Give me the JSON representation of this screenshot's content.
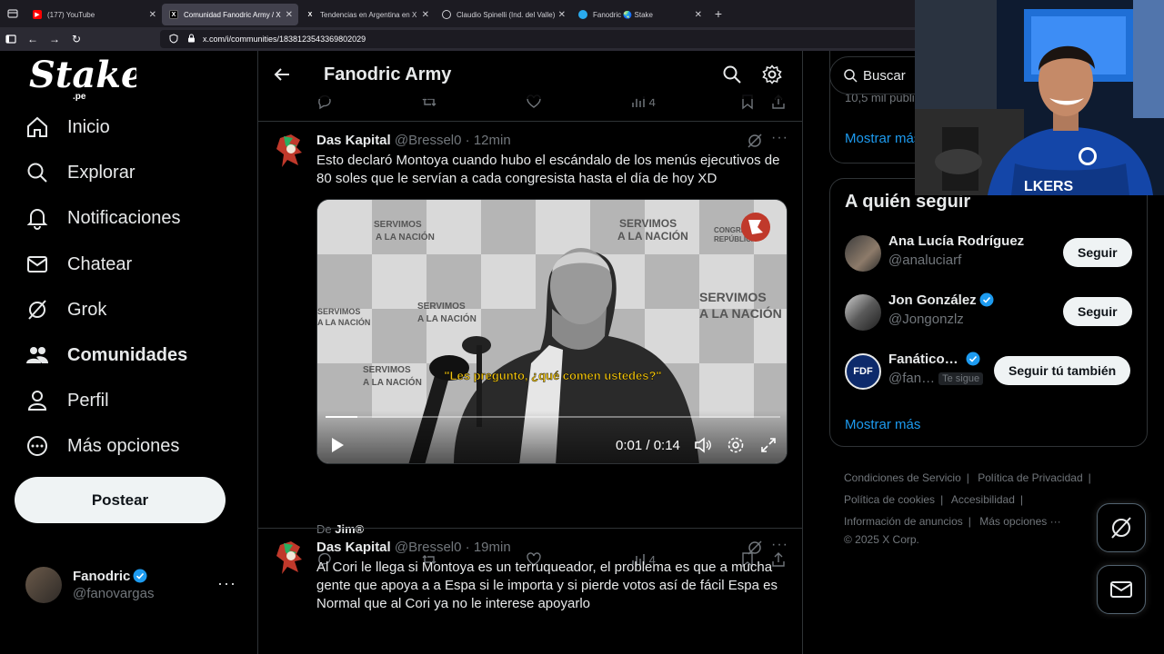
{
  "browser": {
    "tabs": [
      {
        "title": "(177) YouTube",
        "active": false,
        "favicon": "youtube-icon"
      },
      {
        "title": "Comunidad Fanodric Army / X",
        "active": true,
        "favicon": "x-icon"
      },
      {
        "title": "Tendencias en Argentina en X",
        "active": false,
        "favicon": "x-icon"
      },
      {
        "title": "Claudio Spinelli (Ind. del Valle)",
        "active": false,
        "favicon": "globe-icon"
      },
      {
        "title": "Fanodric 🌏 Stake",
        "active": false,
        "favicon": "telegram-icon"
      }
    ],
    "url": "x.com/i/communities/1838123543369802029"
  },
  "brand": {
    "logo_text": "Stake",
    "logo_sub": ".pe"
  },
  "sidebar": {
    "items": [
      {
        "label": "Inicio",
        "icon": "home-icon"
      },
      {
        "label": "Explorar",
        "icon": "search-icon"
      },
      {
        "label": "Notificaciones",
        "icon": "bell-icon"
      },
      {
        "label": "Chatear",
        "icon": "mail-icon"
      },
      {
        "label": "Grok",
        "icon": "grok-icon"
      },
      {
        "label": "Comunidades",
        "icon": "communities-icon"
      },
      {
        "label": "Perfil",
        "icon": "person-icon"
      },
      {
        "label": "Más opciones",
        "icon": "more-circle-icon"
      }
    ],
    "post_label": "Postear",
    "account": {
      "name": "Fanodric",
      "handle": "@fanovargas"
    }
  },
  "main": {
    "title": "Fanodric Army",
    "top_actions": {
      "views": "4"
    },
    "tweets": [
      {
        "display_name": "Das Kapital",
        "username": "@Bressel0",
        "time": "12min",
        "text": "Esto declaró Montoya cuando hubo el escándalo de los menús ejecutivos de 80 soles que le servían a cada congresista hasta el día de hoy XD",
        "video": {
          "caption": "\"Les pregunto, ¿qué comen ustedes?\"",
          "time": "0:01 / 0:14",
          "progress": 0.07,
          "backdrop_words": [
            "SERVIMOS",
            "A LA NACIÓN",
            "CONGRESO",
            "REPÚBLICA"
          ]
        },
        "via_prefix": "De",
        "via_name": "Jim®",
        "views": "4"
      },
      {
        "display_name": "Das Kapital",
        "username": "@Bressel0",
        "time": "19min",
        "text": "Al Cori le llega si Montoya es un terruqueador, el problema es que a mucha gente que apoya a a Espa si le importa y si pierde votos así de fácil Espa es Normal que al Cori ya no le interese apoyarlo"
      }
    ]
  },
  "right": {
    "search_placeholder": "Buscar",
    "faded_text": "10,5 mil publi…",
    "show_more": "Mostrar más",
    "who_to_follow": {
      "title": "A quién seguir",
      "people": [
        {
          "name": "Ana Lucía Rodríguez",
          "handle": "@analuciarf",
          "verified": false,
          "button": "Seguir",
          "follows_you": ""
        },
        {
          "name": "Jon González",
          "handle": "@Jongonzlz",
          "verified": true,
          "button": "Seguir",
          "follows_you": ""
        },
        {
          "name": "Fanático…",
          "handle": "@fan…",
          "verified": true,
          "button": "Seguir tú también",
          "follows_you": "Te sigue",
          "avatar_text": "FDF"
        }
      ],
      "show_more": "Mostrar más"
    },
    "footer": {
      "links": [
        "Condiciones de Servicio",
        "Política de Privacidad",
        "Política de cookies",
        "Accesibilidad",
        "Información de anuncios",
        "Más opciones ···"
      ],
      "copyright": "© 2025 X Corp."
    }
  },
  "colors": {
    "accent": "#1d9bf0",
    "verified": "#1d9bf0",
    "background": "#000000",
    "muted": "#71767b"
  }
}
